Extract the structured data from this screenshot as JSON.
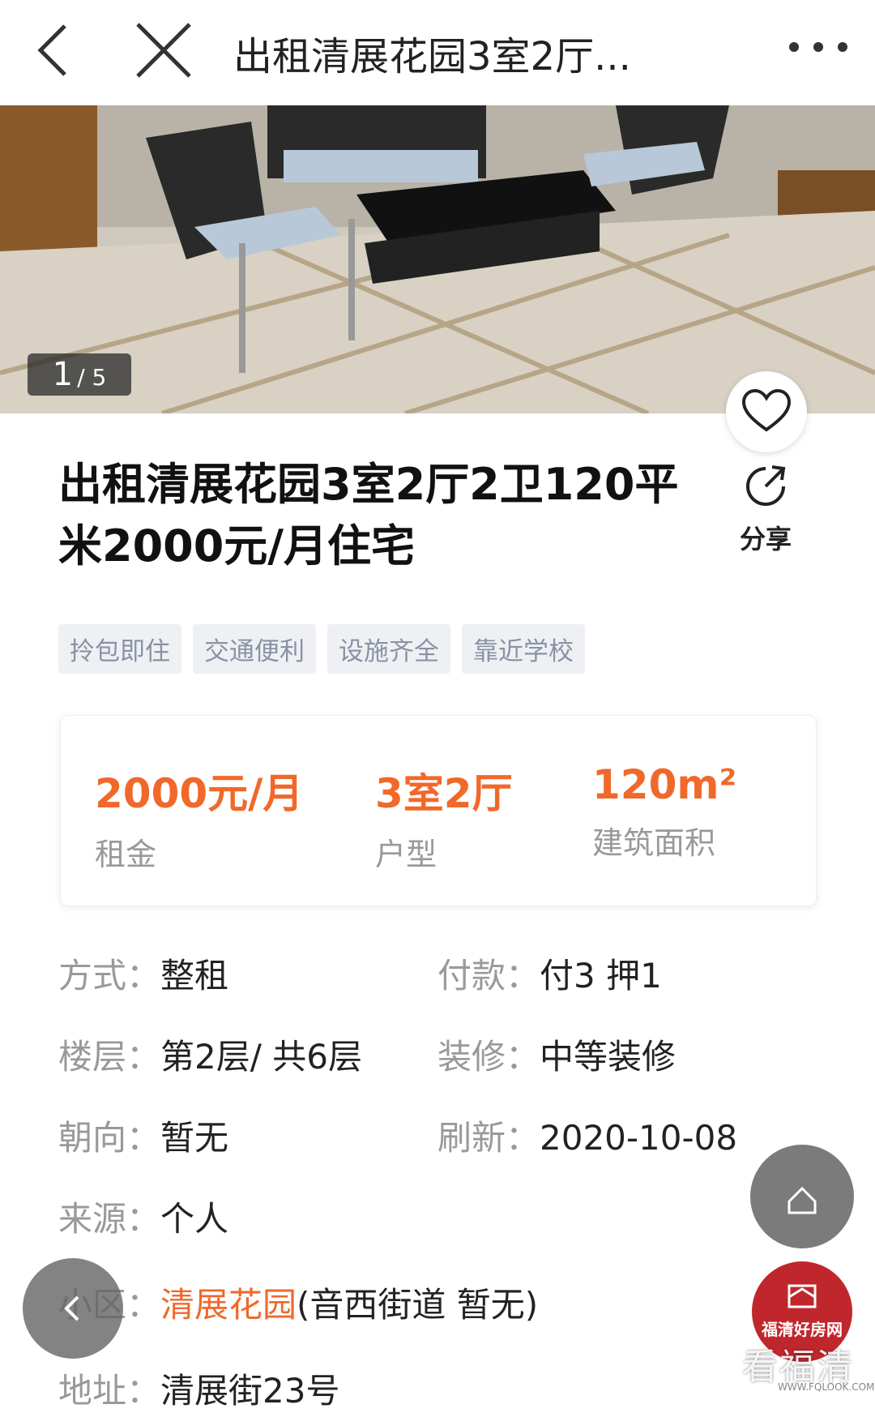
{
  "header": {
    "title": "出租清展花园3室2厅..."
  },
  "gallery": {
    "current": "1",
    "total": "/ 5"
  },
  "listing": {
    "title": "出租清展花园3室2厅2卫120平米2000元/月住宅",
    "share_label": "分享",
    "tags": [
      "拎包即住",
      "交通便利",
      "设施齐全",
      "靠近学校"
    ]
  },
  "summary": {
    "rent_value": "2000元/月",
    "rent_label": "租金",
    "layout_value": "3室2厅",
    "layout_label": "户型",
    "area_value": "120m²",
    "area_label": "建筑面积"
  },
  "details": {
    "mode_key": "方式：",
    "mode_val": "整租",
    "pay_key": "付款：",
    "pay_val": "付3 押1",
    "floor_key": "楼层：",
    "floor_val": "第2层/ 共6层",
    "decor_key": "装修：",
    "decor_val": "中等装修",
    "orient_key": "朝向：",
    "orient_val": "暂无",
    "refresh_key": "刷新：",
    "refresh_val": "2020-10-08",
    "source_key": "来源：",
    "source_val": "个人",
    "community_key": "小区：",
    "community_name": "清展花园",
    "community_extra": "(音西街道 暂无)",
    "address_key": "地址：",
    "address_val": "清展街23号"
  },
  "branding": {
    "logo_text": "福清好房网",
    "watermark": "看福清",
    "watermark_url": "WWW.FQLOOK.COM"
  },
  "colors": {
    "accent": "#f0692a",
    "brand_red": "#c0272d"
  }
}
